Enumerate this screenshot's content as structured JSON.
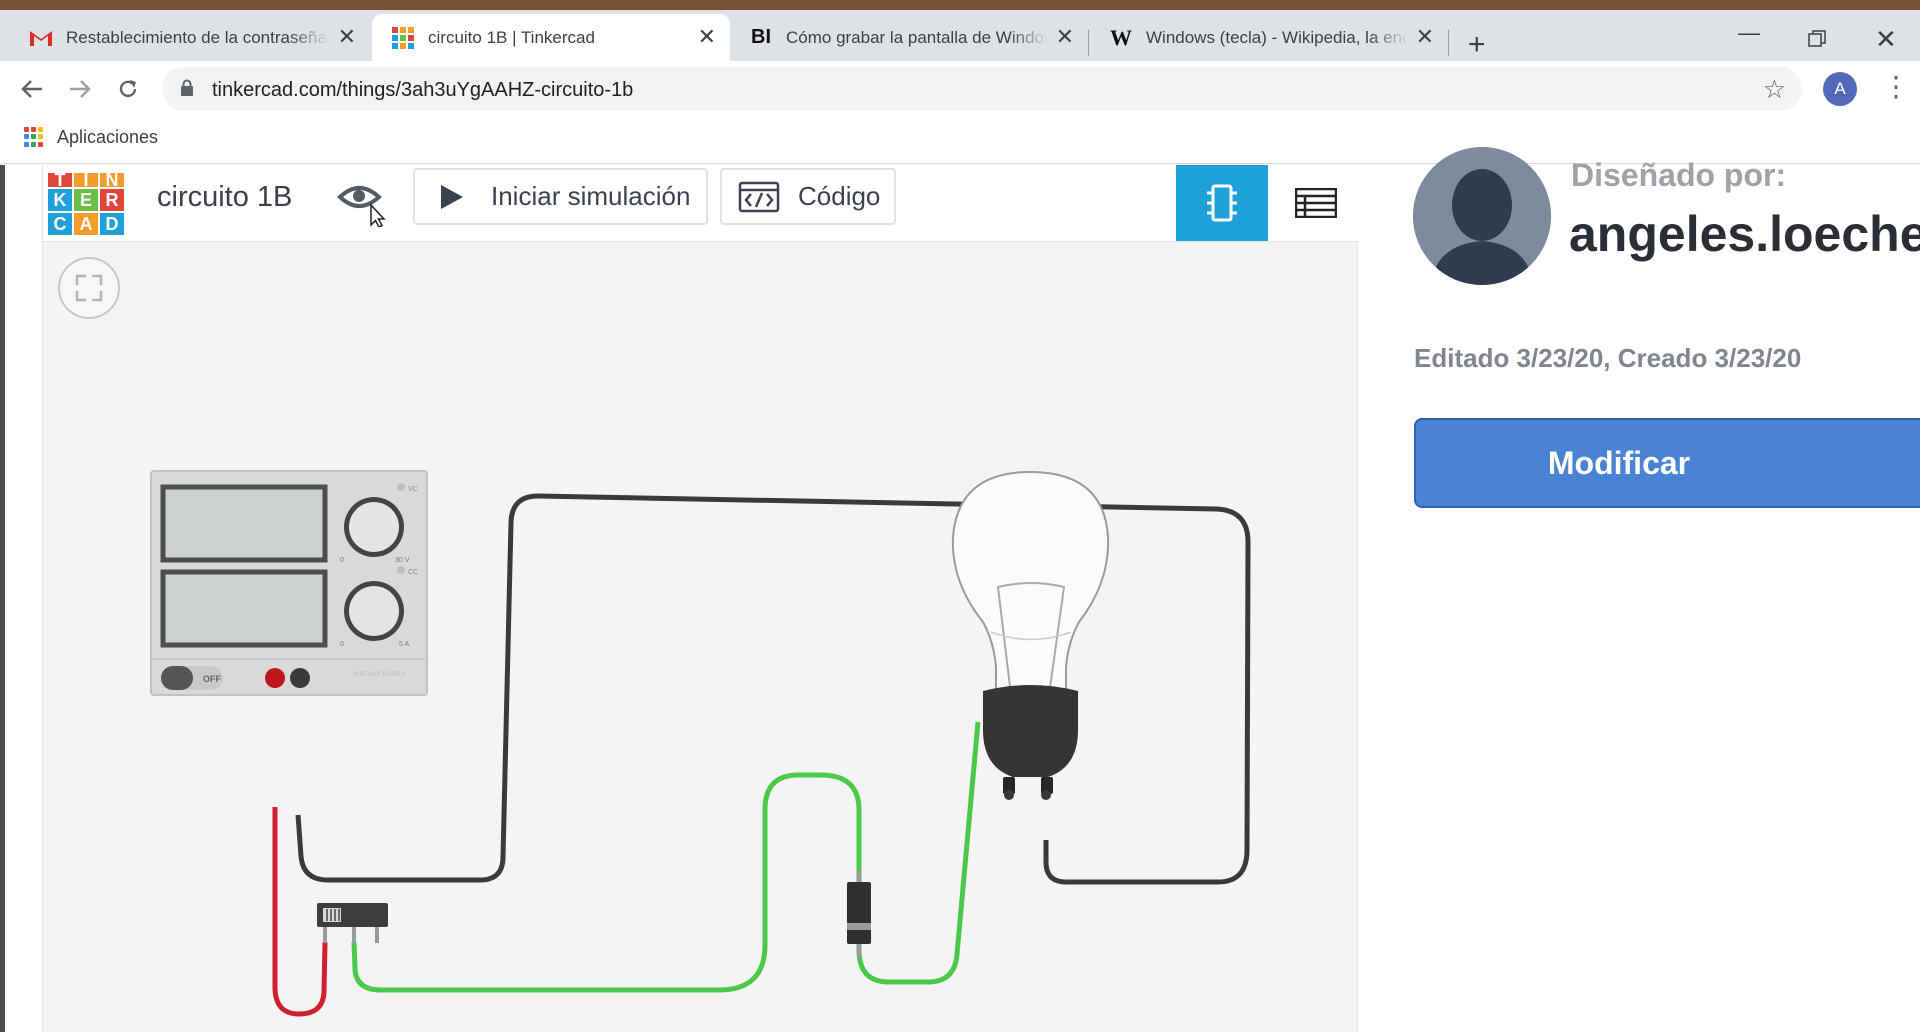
{
  "browser": {
    "tabs": [
      {
        "title": "Restablecimiento de la contraseña",
        "favicon": "gmail-icon",
        "active": false
      },
      {
        "title": "circuito 1B | Tinkercad",
        "favicon": "tinkercad-icon",
        "active": true
      },
      {
        "title": "Cómo grabar la pantalla de Windows",
        "favicon": "BI",
        "active": false
      },
      {
        "title": "Windows (tecla) - Wikipedia, la enciclopedia libre",
        "favicon": "W",
        "active": false
      }
    ],
    "url": "tinkercad.com/things/3ah3uYgAAHZ-circuito-1b",
    "profile_initial": "A",
    "bookmarks": {
      "apps_label": "Aplicaciones"
    }
  },
  "editor": {
    "project_title": "circuito 1B",
    "simulate_label": "Iniciar simulación",
    "code_label": "Código",
    "logo_letters": [
      "T",
      "I",
      "N",
      "K",
      "E",
      "R",
      "C",
      "A",
      "D"
    ],
    "logo_colors": [
      "#e2453c",
      "#f39c2b",
      "#f39c2b",
      "#1ea1d8",
      "#6abe45",
      "#e2453c",
      "#1ea1d8",
      "#f39c2b",
      "#1ea1d8"
    ],
    "power_supply": {
      "switch_label": "OFF",
      "knob1_label": "VC",
      "knob2_label": "CC",
      "scale1": [
        "0",
        "30 V"
      ],
      "scale2": [
        "0",
        "5 A"
      ],
      "brand": "VOLTAGE SUPPLY"
    }
  },
  "side": {
    "designed_by": "Diseñado por:",
    "username": "angeles.loeches",
    "dates": "Editado 3/23/20, Creado 3/23/20",
    "modify_label": "Modificar"
  },
  "colors": {
    "accent": "#1ea1d8",
    "modify": "#4a83d4",
    "wire_black": "#3a3a3a",
    "wire_red": "#d0202e",
    "wire_green": "#4cc84a"
  }
}
